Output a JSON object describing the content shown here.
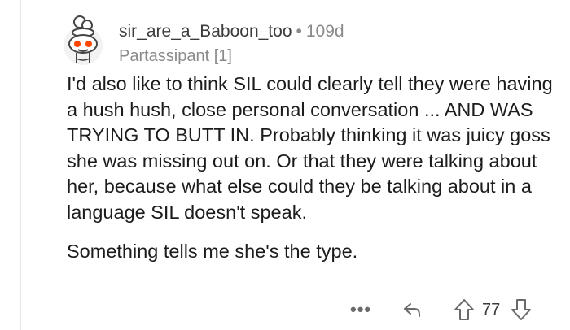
{
  "comment": {
    "username": "sir_are_a_Baboon_too",
    "separator": "•",
    "age": "109d",
    "flair": "Partassipant [1]",
    "paragraphs": [
      "I'd also like to think SIL could clearly tell they were having a hush hush, close personal conversation ... AND WAS TRYING TO BUTT IN. Probably thinking it was juicy goss she was missing out on. Or that they were talking about her, because what else could they be talking about in a language SIL doesn't speak.",
      "Something tells me she's the type."
    ]
  },
  "actions": {
    "more": "•••",
    "score": "77",
    "icons": [
      "more-icon",
      "reply-icon",
      "upvote-icon",
      "downvote-icon"
    ]
  },
  "colors": {
    "text": "#1c1c1c",
    "meta": "#8a8a8a",
    "avatar_accent": "#ff4500",
    "thread_line": "#e6e6e6"
  }
}
